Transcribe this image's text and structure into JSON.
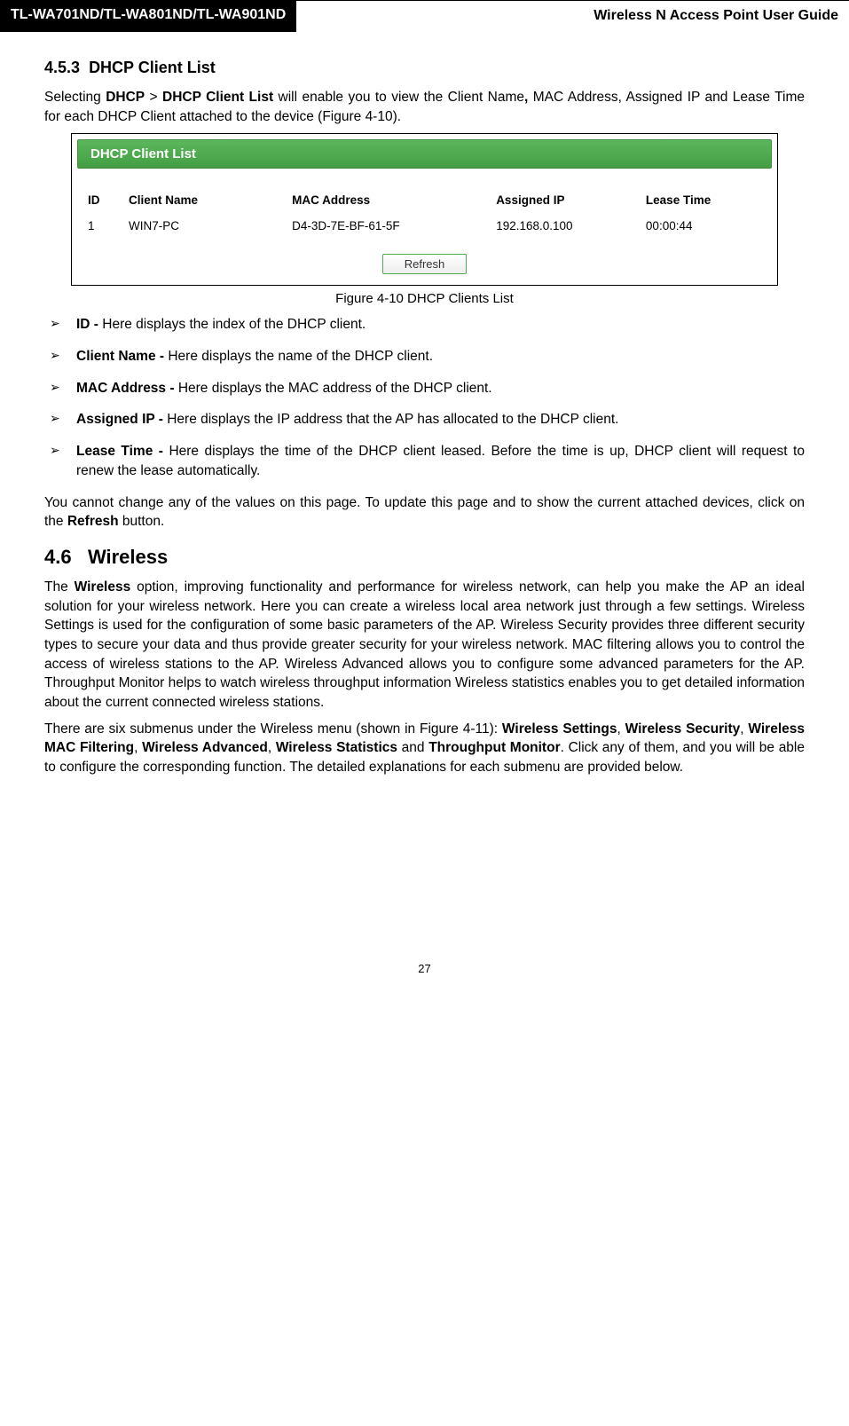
{
  "header": {
    "model": "TL-WA701ND/TL-WA801ND/TL-WA901ND",
    "title": "Wireless N Access Point User Guide"
  },
  "section453": {
    "number": "4.5.3",
    "title": "DHCP Client List",
    "intro_prefix": "Selecting ",
    "intro_bold1": "DHCP",
    "intro_gt": " > ",
    "intro_bold2": "DHCP Client List",
    "intro_tail_prebold": " will enable you to view the Client Name",
    "intro_bold_comma": ",",
    "intro_tail": " MAC Address, Assigned IP and Lease Time for each DHCP Client attached to the device (Figure 4-10)."
  },
  "figure": {
    "header": "DHCP Client List",
    "columns": {
      "id": "ID",
      "name": "Client Name",
      "mac": "MAC Address",
      "ip": "Assigned IP",
      "lease": "Lease Time"
    },
    "row": {
      "id": "1",
      "name": "WIN7-PC",
      "mac": "D4-3D-7E-BF-61-5F",
      "ip": "192.168.0.100",
      "lease": "00:00:44"
    },
    "refresh": "Refresh",
    "caption": "Figure 4-10 DHCP Clients List"
  },
  "bullets": {
    "id_label": "ID - ",
    "id_text": "Here displays the index of the DHCP client.",
    "name_label": "Client Name - ",
    "name_text": "Here displays the name of the DHCP client.",
    "mac_label": "MAC Address - ",
    "mac_text": "Here displays the MAC address of the DHCP client.",
    "ip_label": "Assigned IP - ",
    "ip_text": "Here displays the IP address that the AP has allocated to the DHCP client.",
    "lease_label": "Lease Time - ",
    "lease_text": "Here displays the time of the DHCP client leased. Before the time is up, DHCP client will request to renew the lease automatically."
  },
  "note_para": {
    "pre": "You cannot change any of the values on this page. To update this page and to show the current attached devices, click on the ",
    "bold": "Refresh",
    "post": " button."
  },
  "section46": {
    "number": "4.6",
    "title": "Wireless",
    "p1_pre": "The ",
    "p1_bold": "Wireless",
    "p1_post": " option, improving functionality and performance for wireless network, can help you make the AP an ideal solution for your wireless network. Here you can create a wireless local area network just through a few settings. Wireless Settings is used for the configuration of some basic parameters of the AP. Wireless Security provides three different security types to secure your data and thus provide greater security for your wireless network. MAC filtering allows you to control the access of wireless stations to the AP. Wireless Advanced allows you to configure some advanced parameters for the AP. Throughput Monitor helps to watch wireless throughput information Wireless statistics enables you to get detailed information about the current connected wireless stations.",
    "p2_pre": "There are six submenus under the Wireless menu (shown in Figure 4-11): ",
    "p2_b1": "Wireless Settings",
    "p2_c1": ", ",
    "p2_b2": "Wireless Security",
    "p2_c2": ", ",
    "p2_b3": "Wireless MAC Filtering",
    "p2_c3": ", ",
    "p2_b4": "Wireless Advanced",
    "p2_c4": ", ",
    "p2_b5": "Wireless Statistics",
    "p2_c5": " and ",
    "p2_b6": "Throughput Monitor",
    "p2_post": ". Click any of them, and you will be able to configure the corresponding function. The detailed explanations for each submenu are provided below."
  },
  "page_number": "27"
}
